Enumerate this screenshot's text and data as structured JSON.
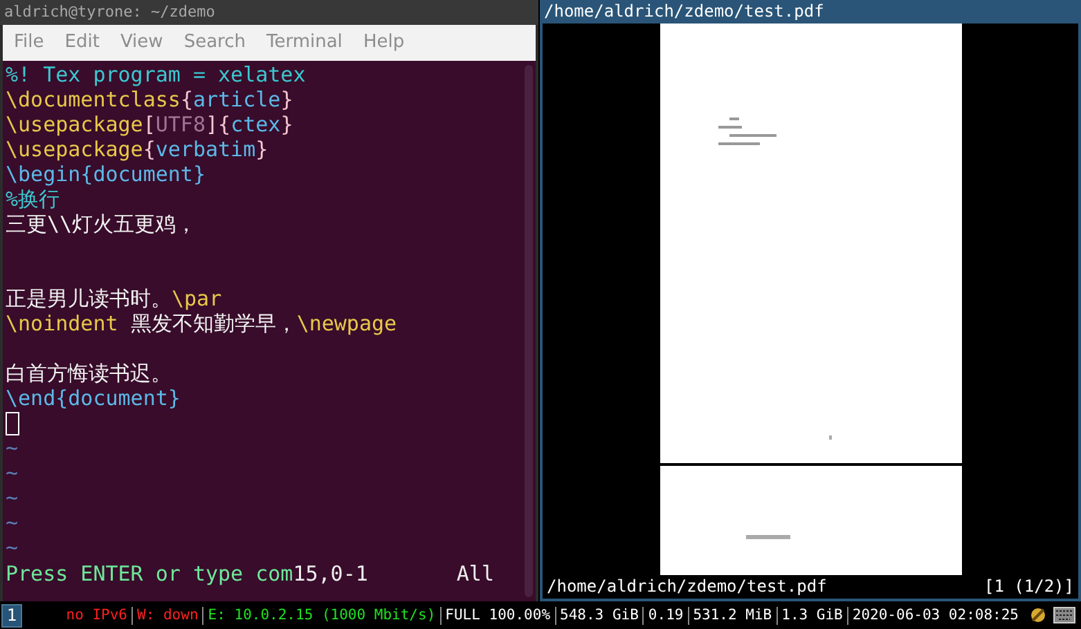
{
  "terminal": {
    "title": "aldrich@tyrone: ~/zdemo",
    "menu": [
      "File",
      "Edit",
      "View",
      "Search",
      "Terminal",
      "Help"
    ],
    "lines": [
      [
        {
          "kind": "comment",
          "text": "%! Tex program = xelatex"
        }
      ],
      [
        {
          "kind": "command",
          "text": "\\documentclass"
        },
        {
          "kind": "brace",
          "text": "{"
        },
        {
          "kind": "arg",
          "text": "article"
        },
        {
          "kind": "brace",
          "text": "}"
        }
      ],
      [
        {
          "kind": "command",
          "text": "\\usepackage"
        },
        {
          "kind": "brace",
          "text": "["
        },
        {
          "kind": "option",
          "text": "UTF8"
        },
        {
          "kind": "brace",
          "text": "]{"
        },
        {
          "kind": "arg",
          "text": "ctex"
        },
        {
          "kind": "brace",
          "text": "}"
        }
      ],
      [
        {
          "kind": "command",
          "text": "\\usepackage"
        },
        {
          "kind": "brace",
          "text": "{"
        },
        {
          "kind": "arg",
          "text": "verbatim"
        },
        {
          "kind": "brace",
          "text": "}"
        }
      ],
      [
        {
          "kind": "env",
          "text": "\\begin{document}"
        }
      ],
      [
        {
          "kind": "comment",
          "text": "%换行"
        }
      ],
      [
        {
          "kind": "plain",
          "text": "三更\\\\灯火五更鸡，"
        }
      ],
      [
        {
          "kind": "blank"
        }
      ],
      [
        {
          "kind": "blank"
        }
      ],
      [
        {
          "kind": "plain",
          "text": "正是男儿读书时。"
        },
        {
          "kind": "command",
          "text": "\\par"
        }
      ],
      [
        {
          "kind": "command",
          "text": "\\noindent"
        },
        {
          "kind": "plain",
          "text": " 黑发不知勤学早，"
        },
        {
          "kind": "command",
          "text": "\\newpage"
        }
      ],
      [
        {
          "kind": "blank"
        }
      ],
      [
        {
          "kind": "plain",
          "text": "白首方悔读书迟。"
        }
      ],
      [
        {
          "kind": "env",
          "text": "\\end{document}"
        }
      ]
    ],
    "tildes": [
      "~",
      "~",
      "~",
      "~",
      "~"
    ],
    "message": "Press ENTER or type com",
    "position": "15,0-1",
    "scroll": "All"
  },
  "viewer": {
    "title": "/home/aldrich/zdemo/test.pdf",
    "path": "/home/aldrich/zdemo/test.pdf",
    "page": "[1 (1/2)]"
  },
  "bar": {
    "workspaces": [
      {
        "label": "1",
        "selected": true
      }
    ],
    "items": [
      {
        "text": "no IPv6",
        "color": "#ff2020"
      },
      {
        "text": "W: down",
        "color": "#ff2020"
      },
      {
        "text": "E: 10.0.2.15 (1000 Mbit/s)",
        "color": "#20e020"
      },
      {
        "text": "FULL 100.00%",
        "color": "#ffffff"
      },
      {
        "text": "548.3 GiB",
        "color": "#ffffff"
      },
      {
        "text": "0.19",
        "color": "#ffffff"
      },
      {
        "text": "531.2 MiB",
        "color": "#ffffff"
      },
      {
        "text": "1.3 GiB",
        "color": "#ffffff"
      },
      {
        "text": "2020-06-03 02:08:25",
        "color": "#ffffff"
      }
    ]
  }
}
